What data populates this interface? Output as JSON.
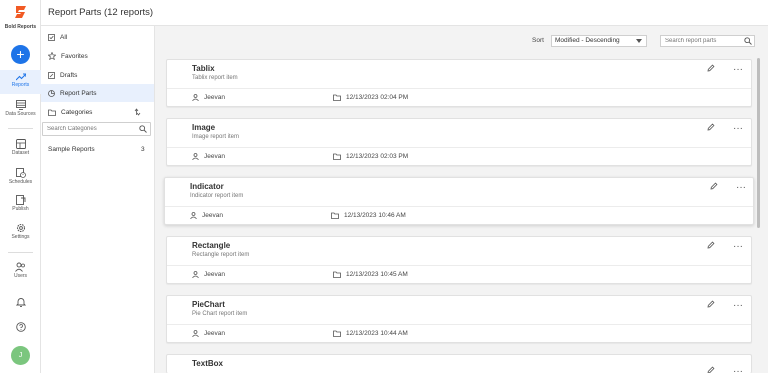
{
  "app": {
    "brand": "Bold Reports",
    "title": "Report Parts (12 reports)"
  },
  "rail": {
    "items": [
      {
        "label": "Reports",
        "icon": "trending-up-icon"
      },
      {
        "label": "Data Sources",
        "icon": "database-icon"
      },
      {
        "label": "Dataset",
        "icon": "dataset-icon"
      },
      {
        "label": "Schedules",
        "icon": "schedule-icon"
      },
      {
        "label": "Publish",
        "icon": "publish-icon"
      },
      {
        "label": "Settings",
        "icon": "gear-icon"
      },
      {
        "label": "Users",
        "icon": "users-icon"
      }
    ],
    "avatar": "J",
    "accent": "#1e74e8"
  },
  "subnav": {
    "items": [
      {
        "label": "All",
        "icon": "checkbox-icon"
      },
      {
        "label": "Favorites",
        "icon": "star-icon"
      },
      {
        "label": "Drafts",
        "icon": "edit-box-icon"
      },
      {
        "label": "Report Parts",
        "icon": "pie-icon"
      },
      {
        "label": "Categories",
        "icon": "folder-icon"
      }
    ],
    "category_search_placeholder": "Search Categories",
    "categories": [
      {
        "name": "Sample Reports",
        "count": "3"
      }
    ]
  },
  "toolbar": {
    "sort_label": "Sort",
    "sort_value": "Modified - Descending",
    "search_placeholder": "Search report parts"
  },
  "cards": [
    {
      "title": "Tablix",
      "subtitle": "Tablix report item",
      "user": "Jeevan",
      "date": "12/13/2023 02:04 PM"
    },
    {
      "title": "Image",
      "subtitle": "Image report item",
      "user": "Jeevan",
      "date": "12/13/2023 02:03 PM"
    },
    {
      "title": "Indicator",
      "subtitle": "Indicator report item",
      "user": "Jeevan",
      "date": "12/13/2023 10:46 AM"
    },
    {
      "title": "Rectangle",
      "subtitle": "Rectangle report item",
      "user": "Jeevan",
      "date": "12/13/2023 10:45 AM"
    },
    {
      "title": "PieChart",
      "subtitle": "Pie Chart report item",
      "user": "Jeevan",
      "date": "12/13/2023 10:44 AM"
    },
    {
      "title": "TextBox",
      "subtitle": "",
      "user": "",
      "date": ""
    }
  ]
}
